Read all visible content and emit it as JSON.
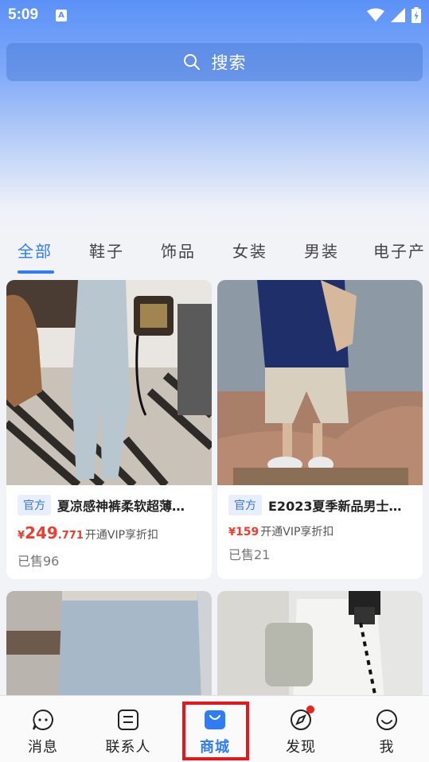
{
  "status_bar": {
    "time": "5:09",
    "notification_icon": "A"
  },
  "search": {
    "label": "搜索"
  },
  "tabs": [
    {
      "label": "全部",
      "active": true
    },
    {
      "label": "鞋子"
    },
    {
      "label": "饰品"
    },
    {
      "label": "女装"
    },
    {
      "label": "男装"
    },
    {
      "label": "电子产"
    }
  ],
  "products": [
    {
      "badge": "官方",
      "title": "夏凉感神裤柔软超薄…",
      "price_yen": "¥",
      "price_int": "249",
      "price_dec": ".771",
      "vip": "开通VIP享折扣",
      "sold": "已售96"
    },
    {
      "badge": "官方",
      "title": "E2023夏季新品男士…",
      "price_yen": "¥",
      "price_int": "159",
      "price_dec": "",
      "vip": "开通VIP享折扣",
      "sold": "已售21"
    }
  ],
  "nav": [
    {
      "label": "消息",
      "icon": "chat-bubble-icon"
    },
    {
      "label": "联系人",
      "icon": "contacts-icon"
    },
    {
      "label": "商城",
      "icon": "shopping-bag-icon",
      "active": true
    },
    {
      "label": "发现",
      "icon": "compass-icon",
      "dot": true
    },
    {
      "label": "我",
      "icon": "smiley-icon"
    }
  ],
  "colors": {
    "accent": "#2f7cf6",
    "price": "#f03b2e",
    "highlight": "#e8151b"
  }
}
